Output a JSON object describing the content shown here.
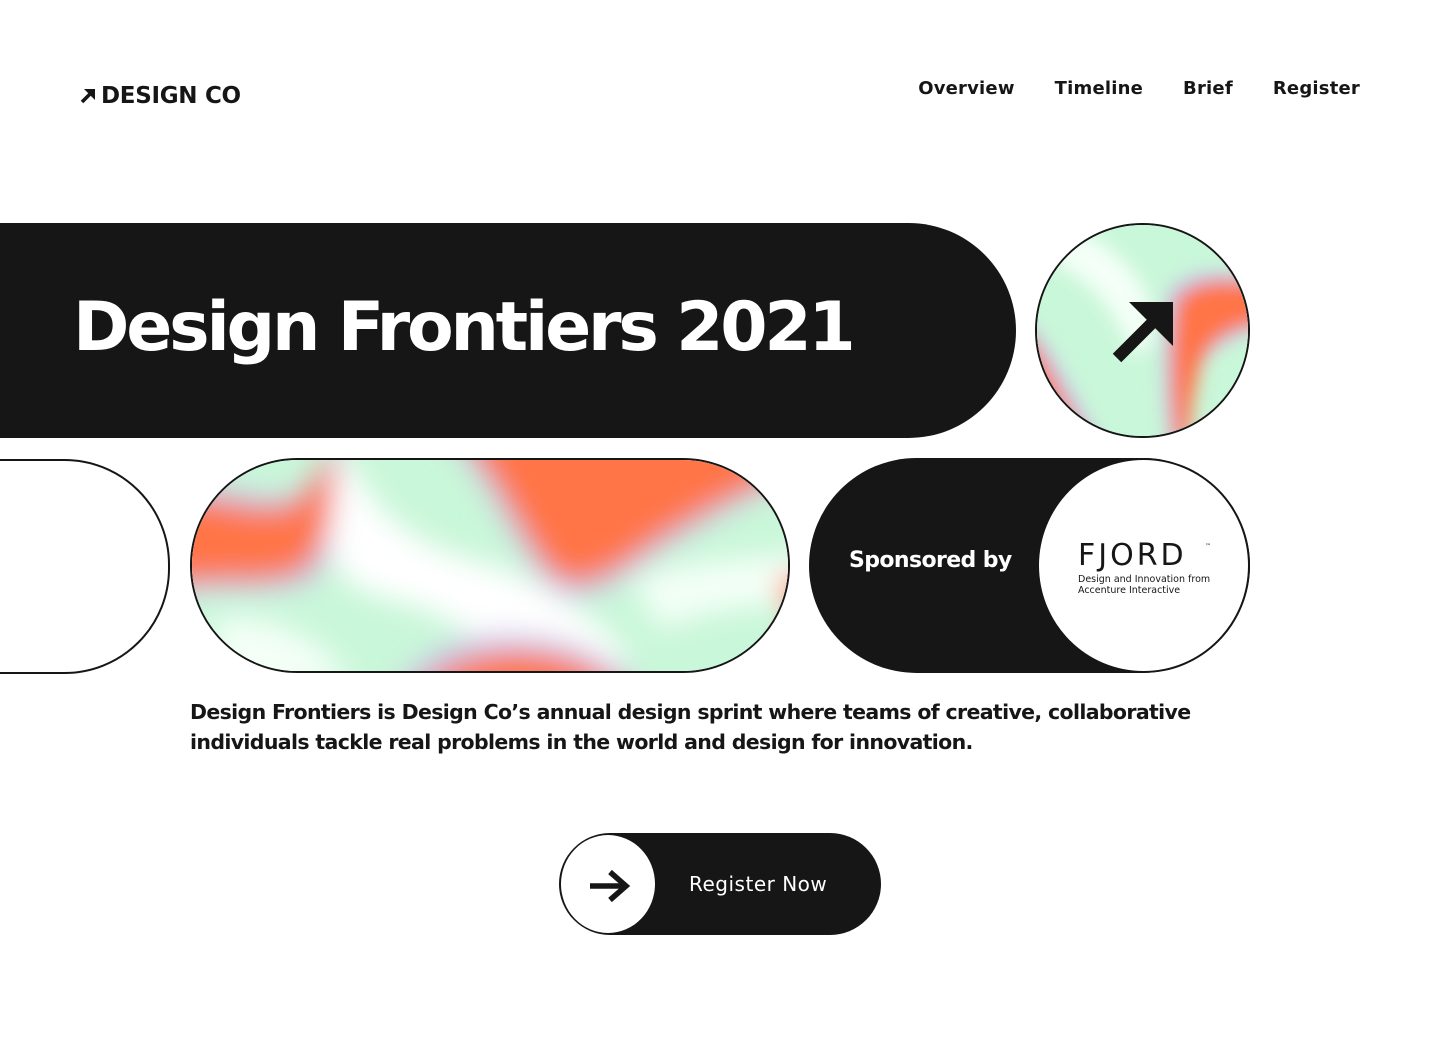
{
  "header": {
    "logo_text": "DESIGN CO",
    "logo_icon": "arrow-up-right-icon",
    "nav": [
      {
        "label": "Overview"
      },
      {
        "label": "Timeline"
      },
      {
        "label": "Brief"
      },
      {
        "label": "Register"
      }
    ]
  },
  "hero": {
    "title": "Design Frontiers 2021",
    "circle_icon": "arrow-up-right-icon"
  },
  "sponsor": {
    "label": "Sponsored by",
    "name": "FJORD",
    "trademark": "™",
    "tagline": "Design and Innovation from Accenture Interactive"
  },
  "description": "Design Frontiers is Design Co’s annual design sprint where teams of creative, collaborative individuals tackle real problems in the world and design for innovation.",
  "cta": {
    "label": "Register Now",
    "icon": "arrow-right-icon"
  },
  "colors": {
    "ink": "#161616",
    "background": "#FFFFFF",
    "accent_orange": "#FF7447",
    "accent_mint": "#C9F7D9",
    "accent_lavender": "#C8C3E8"
  }
}
